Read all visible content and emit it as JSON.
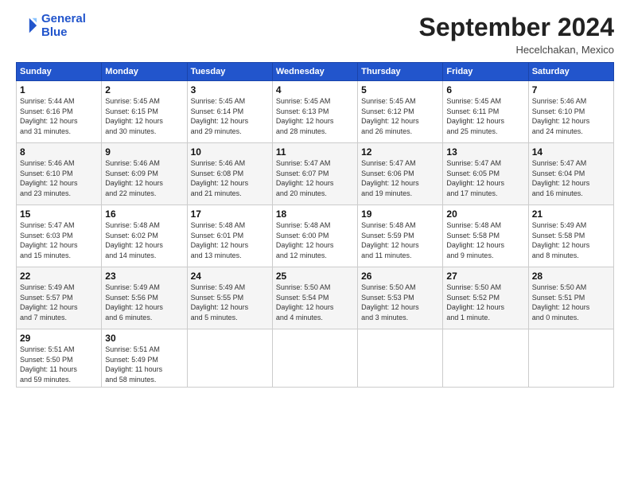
{
  "header": {
    "logo_line1": "General",
    "logo_line2": "Blue",
    "month_title": "September 2024",
    "location": "Hecelchakan, Mexico"
  },
  "columns": [
    "Sunday",
    "Monday",
    "Tuesday",
    "Wednesday",
    "Thursday",
    "Friday",
    "Saturday"
  ],
  "weeks": [
    [
      {
        "day": "1",
        "info": "Sunrise: 5:44 AM\nSunset: 6:16 PM\nDaylight: 12 hours\nand 31 minutes."
      },
      {
        "day": "2",
        "info": "Sunrise: 5:45 AM\nSunset: 6:15 PM\nDaylight: 12 hours\nand 30 minutes."
      },
      {
        "day": "3",
        "info": "Sunrise: 5:45 AM\nSunset: 6:14 PM\nDaylight: 12 hours\nand 29 minutes."
      },
      {
        "day": "4",
        "info": "Sunrise: 5:45 AM\nSunset: 6:13 PM\nDaylight: 12 hours\nand 28 minutes."
      },
      {
        "day": "5",
        "info": "Sunrise: 5:45 AM\nSunset: 6:12 PM\nDaylight: 12 hours\nand 26 minutes."
      },
      {
        "day": "6",
        "info": "Sunrise: 5:45 AM\nSunset: 6:11 PM\nDaylight: 12 hours\nand 25 minutes."
      },
      {
        "day": "7",
        "info": "Sunrise: 5:46 AM\nSunset: 6:10 PM\nDaylight: 12 hours\nand 24 minutes."
      }
    ],
    [
      {
        "day": "8",
        "info": "Sunrise: 5:46 AM\nSunset: 6:10 PM\nDaylight: 12 hours\nand 23 minutes."
      },
      {
        "day": "9",
        "info": "Sunrise: 5:46 AM\nSunset: 6:09 PM\nDaylight: 12 hours\nand 22 minutes."
      },
      {
        "day": "10",
        "info": "Sunrise: 5:46 AM\nSunset: 6:08 PM\nDaylight: 12 hours\nand 21 minutes."
      },
      {
        "day": "11",
        "info": "Sunrise: 5:47 AM\nSunset: 6:07 PM\nDaylight: 12 hours\nand 20 minutes."
      },
      {
        "day": "12",
        "info": "Sunrise: 5:47 AM\nSunset: 6:06 PM\nDaylight: 12 hours\nand 19 minutes."
      },
      {
        "day": "13",
        "info": "Sunrise: 5:47 AM\nSunset: 6:05 PM\nDaylight: 12 hours\nand 17 minutes."
      },
      {
        "day": "14",
        "info": "Sunrise: 5:47 AM\nSunset: 6:04 PM\nDaylight: 12 hours\nand 16 minutes."
      }
    ],
    [
      {
        "day": "15",
        "info": "Sunrise: 5:47 AM\nSunset: 6:03 PM\nDaylight: 12 hours\nand 15 minutes."
      },
      {
        "day": "16",
        "info": "Sunrise: 5:48 AM\nSunset: 6:02 PM\nDaylight: 12 hours\nand 14 minutes."
      },
      {
        "day": "17",
        "info": "Sunrise: 5:48 AM\nSunset: 6:01 PM\nDaylight: 12 hours\nand 13 minutes."
      },
      {
        "day": "18",
        "info": "Sunrise: 5:48 AM\nSunset: 6:00 PM\nDaylight: 12 hours\nand 12 minutes."
      },
      {
        "day": "19",
        "info": "Sunrise: 5:48 AM\nSunset: 5:59 PM\nDaylight: 12 hours\nand 11 minutes."
      },
      {
        "day": "20",
        "info": "Sunrise: 5:48 AM\nSunset: 5:58 PM\nDaylight: 12 hours\nand 9 minutes."
      },
      {
        "day": "21",
        "info": "Sunrise: 5:49 AM\nSunset: 5:58 PM\nDaylight: 12 hours\nand 8 minutes."
      }
    ],
    [
      {
        "day": "22",
        "info": "Sunrise: 5:49 AM\nSunset: 5:57 PM\nDaylight: 12 hours\nand 7 minutes."
      },
      {
        "day": "23",
        "info": "Sunrise: 5:49 AM\nSunset: 5:56 PM\nDaylight: 12 hours\nand 6 minutes."
      },
      {
        "day": "24",
        "info": "Sunrise: 5:49 AM\nSunset: 5:55 PM\nDaylight: 12 hours\nand 5 minutes."
      },
      {
        "day": "25",
        "info": "Sunrise: 5:50 AM\nSunset: 5:54 PM\nDaylight: 12 hours\nand 4 minutes."
      },
      {
        "day": "26",
        "info": "Sunrise: 5:50 AM\nSunset: 5:53 PM\nDaylight: 12 hours\nand 3 minutes."
      },
      {
        "day": "27",
        "info": "Sunrise: 5:50 AM\nSunset: 5:52 PM\nDaylight: 12 hours\nand 1 minute."
      },
      {
        "day": "28",
        "info": "Sunrise: 5:50 AM\nSunset: 5:51 PM\nDaylight: 12 hours\nand 0 minutes."
      }
    ],
    [
      {
        "day": "29",
        "info": "Sunrise: 5:51 AM\nSunset: 5:50 PM\nDaylight: 11 hours\nand 59 minutes."
      },
      {
        "day": "30",
        "info": "Sunrise: 5:51 AM\nSunset: 5:49 PM\nDaylight: 11 hours\nand 58 minutes."
      },
      {
        "day": "",
        "info": ""
      },
      {
        "day": "",
        "info": ""
      },
      {
        "day": "",
        "info": ""
      },
      {
        "day": "",
        "info": ""
      },
      {
        "day": "",
        "info": ""
      }
    ]
  ]
}
